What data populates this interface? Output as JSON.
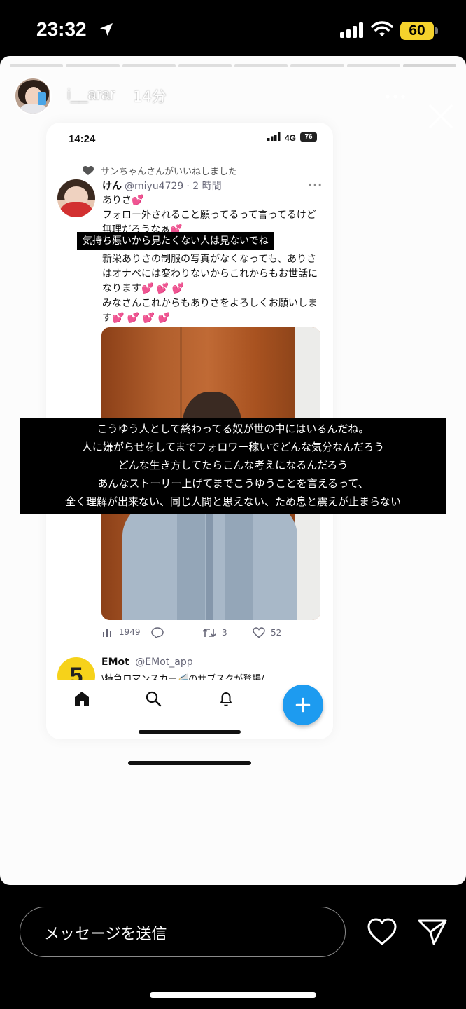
{
  "status_bar": {
    "time": "23:32",
    "battery": "60"
  },
  "story": {
    "username": "i__arar",
    "time_ago": "14分",
    "progress": {
      "total_segments": 8,
      "completed_segments": 7
    }
  },
  "screenshot": {
    "status": {
      "time": "14:24",
      "network": "4G",
      "battery": "76"
    },
    "liked_by": "サンちゃんさんがいいねしました",
    "tweet": {
      "display_name": "けん",
      "handle": "@miyu4729",
      "time": "· 2 時間",
      "line1": "ありさ",
      "line1_emoji": "💕",
      "line2": "フォロー外されること願ってるって言ってるけど無理だろうなぁ",
      "line2_emoji": "💕",
      "line3": "新栄ありさの制服の写真がなくなっても、ありさはオナペには変わりないからこれからもお世話になります",
      "line3_emoji": "💕 💕 💕",
      "line4": "みなさんこれからもありさをよろしくお願いします",
      "line4_emoji": "💕 💕 💕 💕",
      "stats": {
        "views": "1949",
        "replies": "",
        "retweets": "3",
        "likes": "52"
      }
    },
    "next_tweet": {
      "display_name": "EMot",
      "handle": "@EMot_app",
      "text": "\\特急ロマンスカー🚄のサブスクが登場/"
    }
  },
  "captions": {
    "small": "気持ち悪いから見たくない人は見ないでね",
    "big": [
      "こうゆう人として終わってる奴が世の中にはいるんだね。",
      "人に嫌がらせをしてまでフォロワー稼いでどんな気分なんだろう",
      "どんな生き方してたらこんな考えになるんだろう",
      "あんなストーリー上げてまでこうゆうことを言えるって、",
      "全く理解が出来ない、同じ人間と思えない、ため息と震えが止まらない"
    ]
  },
  "reply": {
    "placeholder": "メッセージを送信"
  },
  "icons": {
    "location": "location-arrow-icon",
    "signal": "signal-icon",
    "wifi": "wifi-icon",
    "like": "heart-icon",
    "send": "send-icon",
    "close": "close-icon",
    "more": "more-icon"
  }
}
